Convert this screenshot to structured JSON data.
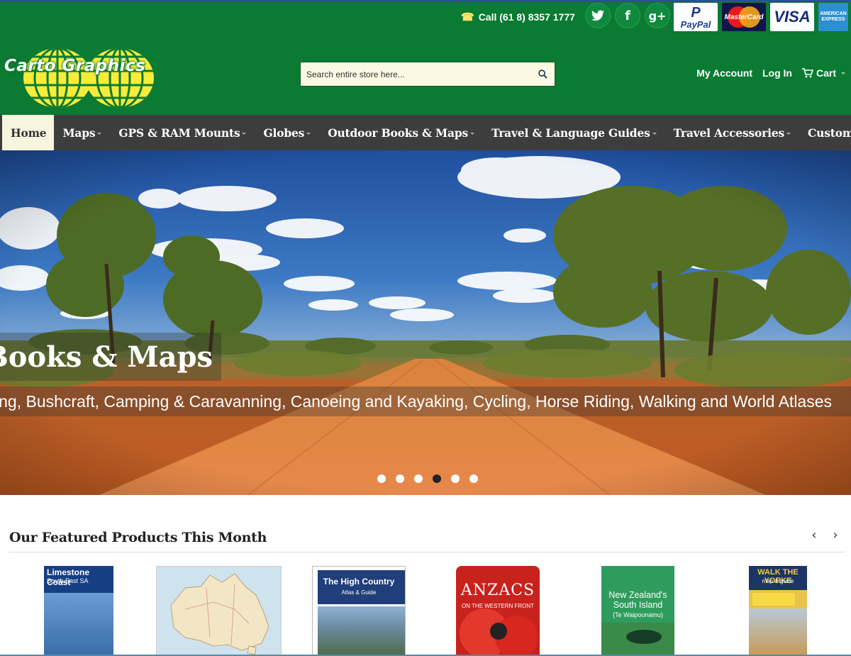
{
  "header": {
    "phone": "Call (61 8) 8357 1777",
    "social": {
      "twitter": "🐦",
      "facebook": "f",
      "googleplus": "g+"
    },
    "payments": {
      "paypal_top": "P",
      "paypal": "PayPal",
      "mastercard": "MasterCard",
      "visa": "VISA",
      "amex_line1": "AMERICAN",
      "amex_line2": "EXPRESS"
    },
    "logo_text": "Carto Graphics",
    "search_placeholder": "Search entire store here...",
    "my_account": "My Account",
    "log_in": "Log In",
    "cart": "Cart"
  },
  "nav": {
    "items": [
      {
        "label": "Home",
        "active": true,
        "dropdown": false
      },
      {
        "label": "Maps",
        "dropdown": true
      },
      {
        "label": "GPS & RAM Mounts",
        "dropdown": true
      },
      {
        "label": "Globes",
        "dropdown": true
      },
      {
        "label": "Outdoor Books & Maps",
        "dropdown": true
      },
      {
        "label": "Travel & Language Guides",
        "dropdown": true
      },
      {
        "label": "Travel Accessories",
        "dropdown": true
      },
      {
        "label": "Custom Maps",
        "dropdown": false
      }
    ]
  },
  "hero": {
    "title": "Books & Maps",
    "caption": "ing, Bushcraft, Camping & Caravanning, Canoeing and Kayaking, Cycling, Horse Riding, Walking and World Atlases",
    "slide_count": 6,
    "active_slide": 4
  },
  "featured": {
    "title": "Our Featured Products This Month",
    "prev": "‹",
    "next": "›",
    "products": [
      {
        "title": "Limestone Coast",
        "subtitle": "South East SA"
      },
      {
        "title": "",
        "subtitle": ""
      },
      {
        "title": "The High Country",
        "subtitle": "Atlas & Guide"
      },
      {
        "title": "ANZACS",
        "subtitle": "ON THE WESTERN FRONT"
      },
      {
        "title": "New Zealand's South Island",
        "subtitle": "(Te Waipounamu)"
      },
      {
        "title": "WALK THE YORKE",
        "subtitle": "map & guide"
      }
    ]
  },
  "colors": {
    "header_green": "#0b7a32",
    "nav_dark": "#3d3d3d",
    "nav_active_bg": "#f8f5df"
  }
}
